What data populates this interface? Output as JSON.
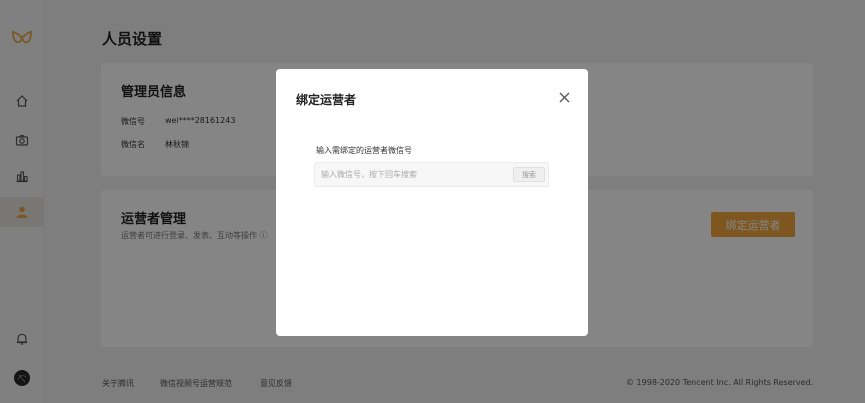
{
  "page": {
    "title": "人员设置"
  },
  "admin": {
    "title": "管理员信息",
    "wechat_id_label": "微信号",
    "wechat_id_value": "wei****28161243",
    "wechat_name_label": "微信名",
    "wechat_name_value": "林秋锦"
  },
  "operator": {
    "title": "运营者管理",
    "desc": "运营者可进行登录、发表、互动等操作 ⓘ",
    "bind_button": "绑定运营者"
  },
  "footer": {
    "links": [
      "关于腾讯",
      "微信视频号运营规范",
      "意见反馈"
    ],
    "copyright": "© 1998-2020 Tencent Inc. All Rights Reserved."
  },
  "modal": {
    "title": "绑定运营者",
    "field_label": "输入需绑定的运营者微信号",
    "search_placeholder": "输入微信号，按下回车搜索",
    "search_button": "搜索"
  },
  "colors": {
    "accent": "#f0a63f",
    "logo": "#e8a94a"
  },
  "icons": [
    "logo-icon",
    "home-icon",
    "camera-icon",
    "chart-icon",
    "user-icon",
    "bell-icon",
    "avatar"
  ]
}
